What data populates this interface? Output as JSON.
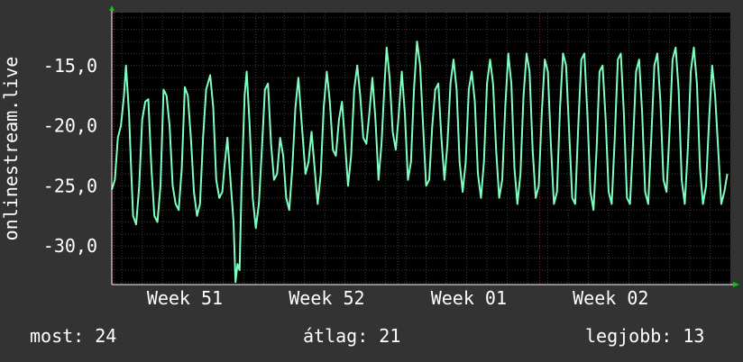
{
  "chart_data": {
    "type": "line",
    "ylabel": "onlinestream.live",
    "y_ticks": [
      "-15,0",
      "-20,0",
      "-25,0",
      "-30,0"
    ],
    "y_tick_values": [
      -15,
      -20,
      -25,
      -30
    ],
    "ylim": [
      -33.2,
      -10.6
    ],
    "x_tick_labels": [
      "Week 51",
      "Week 52",
      "Week 01",
      "Week 02"
    ],
    "x_tick_positions": [
      3.6,
      10.6,
      17.6,
      24.6
    ],
    "xlim": [
      0,
      30.5
    ],
    "grid": true,
    "colors": {
      "line": "#7fffbf",
      "background": "#000000",
      "frame": "#333333",
      "text": "#ffffff",
      "grid_minor": "#3a3a3a",
      "grid_major": "#8b2a2a"
    },
    "series": [
      {
        "values": [
          [
            0.0,
            -25.3
          ],
          [
            0.15,
            -24.5
          ],
          [
            0.3,
            -21.0
          ],
          [
            0.45,
            -20.0
          ],
          [
            0.6,
            -17.5
          ],
          [
            0.7,
            -15.0
          ],
          [
            0.85,
            -19.0
          ],
          [
            0.95,
            -23.5
          ],
          [
            1.05,
            -27.5
          ],
          [
            1.2,
            -28.2
          ],
          [
            1.35,
            -25.0
          ],
          [
            1.5,
            -19.5
          ],
          [
            1.65,
            -18.0
          ],
          [
            1.8,
            -17.8
          ],
          [
            1.95,
            -23.5
          ],
          [
            2.1,
            -27.5
          ],
          [
            2.25,
            -28.0
          ],
          [
            2.4,
            -25.0
          ],
          [
            2.55,
            -17.0
          ],
          [
            2.7,
            -17.5
          ],
          [
            2.85,
            -20.0
          ],
          [
            3.0,
            -25.0
          ],
          [
            3.15,
            -26.5
          ],
          [
            3.3,
            -27.0
          ],
          [
            3.45,
            -23.5
          ],
          [
            3.6,
            -16.8
          ],
          [
            3.75,
            -17.5
          ],
          [
            3.9,
            -21.0
          ],
          [
            4.05,
            -25.5
          ],
          [
            4.2,
            -27.5
          ],
          [
            4.35,
            -26.5
          ],
          [
            4.5,
            -21.0
          ],
          [
            4.65,
            -17.0
          ],
          [
            4.85,
            -15.8
          ],
          [
            5.0,
            -18.5
          ],
          [
            5.15,
            -24.5
          ],
          [
            5.3,
            -26.0
          ],
          [
            5.45,
            -25.5
          ],
          [
            5.55,
            -23.5
          ],
          [
            5.7,
            -21.0
          ],
          [
            5.85,
            -24.5
          ],
          [
            6.0,
            -28.0
          ],
          [
            6.1,
            -33.0
          ],
          [
            6.2,
            -31.5
          ],
          [
            6.3,
            -32.0
          ],
          [
            6.4,
            -25.0
          ],
          [
            6.55,
            -17.5
          ],
          [
            6.65,
            -15.5
          ],
          [
            6.8,
            -20.0
          ],
          [
            6.95,
            -26.0
          ],
          [
            7.1,
            -28.5
          ],
          [
            7.25,
            -26.5
          ],
          [
            7.4,
            -22.0
          ],
          [
            7.55,
            -17.0
          ],
          [
            7.7,
            -16.5
          ],
          [
            7.85,
            -21.5
          ],
          [
            8.0,
            -24.5
          ],
          [
            8.15,
            -24.0
          ],
          [
            8.3,
            -21.0
          ],
          [
            8.45,
            -22.5
          ],
          [
            8.6,
            -26.0
          ],
          [
            8.75,
            -27.0
          ],
          [
            8.9,
            -23.5
          ],
          [
            9.05,
            -18.5
          ],
          [
            9.2,
            -16.0
          ],
          [
            9.35,
            -19.5
          ],
          [
            9.55,
            -24.0
          ],
          [
            9.7,
            -23.0
          ],
          [
            9.85,
            -20.5
          ],
          [
            10.0,
            -23.5
          ],
          [
            10.15,
            -26.5
          ],
          [
            10.3,
            -24.0
          ],
          [
            10.45,
            -18.5
          ],
          [
            10.6,
            -15.5
          ],
          [
            10.75,
            -18.0
          ],
          [
            10.9,
            -22.0
          ],
          [
            11.05,
            -22.5
          ],
          [
            11.2,
            -19.5
          ],
          [
            11.35,
            -18.0
          ],
          [
            11.5,
            -21.5
          ],
          [
            11.65,
            -25.0
          ],
          [
            11.8,
            -22.5
          ],
          [
            11.95,
            -17.0
          ],
          [
            12.1,
            -15.0
          ],
          [
            12.25,
            -17.5
          ],
          [
            12.4,
            -21.0
          ],
          [
            12.55,
            -21.5
          ],
          [
            12.7,
            -19.0
          ],
          [
            12.85,
            -16.0
          ],
          [
            13.0,
            -19.5
          ],
          [
            13.15,
            -24.5
          ],
          [
            13.3,
            -21.5
          ],
          [
            13.45,
            -16.5
          ],
          [
            13.55,
            -13.5
          ],
          [
            13.7,
            -16.0
          ],
          [
            13.85,
            -20.5
          ],
          [
            14.0,
            -22.0
          ],
          [
            14.15,
            -19.0
          ],
          [
            14.3,
            -15.5
          ],
          [
            14.45,
            -19.0
          ],
          [
            14.6,
            -24.5
          ],
          [
            14.75,
            -23.0
          ],
          [
            14.9,
            -17.0
          ],
          [
            15.05,
            -13.0
          ],
          [
            15.2,
            -15.0
          ],
          [
            15.35,
            -20.0
          ],
          [
            15.5,
            -25.0
          ],
          [
            15.65,
            -24.5
          ],
          [
            15.8,
            -20.0
          ],
          [
            15.95,
            -17.0
          ],
          [
            16.1,
            -16.5
          ],
          [
            16.25,
            -21.0
          ],
          [
            16.4,
            -24.5
          ],
          [
            16.55,
            -21.5
          ],
          [
            16.7,
            -16.5
          ],
          [
            16.85,
            -14.5
          ],
          [
            17.0,
            -17.0
          ],
          [
            17.15,
            -23.0
          ],
          [
            17.3,
            -25.5
          ],
          [
            17.45,
            -23.0
          ],
          [
            17.6,
            -17.0
          ],
          [
            17.75,
            -15.5
          ],
          [
            17.9,
            -18.0
          ],
          [
            18.05,
            -24.0
          ],
          [
            18.2,
            -26.0
          ],
          [
            18.35,
            -23.0
          ],
          [
            18.5,
            -16.5
          ],
          [
            18.65,
            -14.5
          ],
          [
            18.8,
            -16.5
          ],
          [
            18.95,
            -22.0
          ],
          [
            19.1,
            -26.0
          ],
          [
            19.25,
            -24.5
          ],
          [
            19.4,
            -18.5
          ],
          [
            19.55,
            -14.0
          ],
          [
            19.7,
            -16.5
          ],
          [
            19.85,
            -23.5
          ],
          [
            20.0,
            -26.5
          ],
          [
            20.15,
            -24.0
          ],
          [
            20.3,
            -17.5
          ],
          [
            20.45,
            -14.0
          ],
          [
            20.6,
            -15.5
          ],
          [
            20.75,
            -22.0
          ],
          [
            20.9,
            -26.0
          ],
          [
            21.05,
            -25.0
          ],
          [
            21.2,
            -19.0
          ],
          [
            21.35,
            -14.5
          ],
          [
            21.5,
            -15.5
          ],
          [
            21.65,
            -21.5
          ],
          [
            21.8,
            -26.5
          ],
          [
            21.95,
            -25.5
          ],
          [
            22.1,
            -18.5
          ],
          [
            22.25,
            -14.0
          ],
          [
            22.4,
            -15.0
          ],
          [
            22.55,
            -20.5
          ],
          [
            22.7,
            -26.0
          ],
          [
            22.85,
            -26.5
          ],
          [
            23.0,
            -20.0
          ],
          [
            23.15,
            -14.5
          ],
          [
            23.3,
            -14.0
          ],
          [
            23.45,
            -19.0
          ],
          [
            23.6,
            -25.5
          ],
          [
            23.75,
            -27.0
          ],
          [
            23.9,
            -22.0
          ],
          [
            24.05,
            -15.5
          ],
          [
            24.2,
            -15.0
          ],
          [
            24.35,
            -19.5
          ],
          [
            24.5,
            -25.5
          ],
          [
            24.65,
            -26.5
          ],
          [
            24.8,
            -21.0
          ],
          [
            24.95,
            -14.5
          ],
          [
            25.1,
            -14.0
          ],
          [
            25.25,
            -19.0
          ],
          [
            25.4,
            -26.0
          ],
          [
            25.55,
            -26.5
          ],
          [
            25.7,
            -21.5
          ],
          [
            25.85,
            -15.5
          ],
          [
            26.0,
            -14.5
          ],
          [
            26.15,
            -19.0
          ],
          [
            26.3,
            -25.5
          ],
          [
            26.45,
            -26.5
          ],
          [
            26.6,
            -21.0
          ],
          [
            26.75,
            -15.0
          ],
          [
            26.9,
            -14.0
          ],
          [
            27.05,
            -18.0
          ],
          [
            27.2,
            -24.5
          ],
          [
            27.35,
            -25.5
          ],
          [
            27.5,
            -20.5
          ],
          [
            27.65,
            -14.5
          ],
          [
            27.8,
            -13.5
          ],
          [
            27.95,
            -17.0
          ],
          [
            28.1,
            -24.5
          ],
          [
            28.25,
            -26.5
          ],
          [
            28.4,
            -22.0
          ],
          [
            28.55,
            -15.5
          ],
          [
            28.7,
            -13.5
          ],
          [
            28.85,
            -16.5
          ],
          [
            29.0,
            -23.5
          ],
          [
            29.15,
            -26.5
          ],
          [
            29.3,
            -25.0
          ],
          [
            29.45,
            -19.5
          ],
          [
            29.6,
            -15.0
          ],
          [
            29.75,
            -17.5
          ],
          [
            29.9,
            -22.0
          ],
          [
            30.05,
            -26.5
          ],
          [
            30.2,
            -25.5
          ],
          [
            30.35,
            -24.0
          ]
        ]
      }
    ]
  },
  "stats": {
    "now_label": "most:",
    "now_value": "24",
    "avg_label": "átlag:",
    "avg_value": "21",
    "max_label": "legjobb:",
    "max_value": "13"
  }
}
